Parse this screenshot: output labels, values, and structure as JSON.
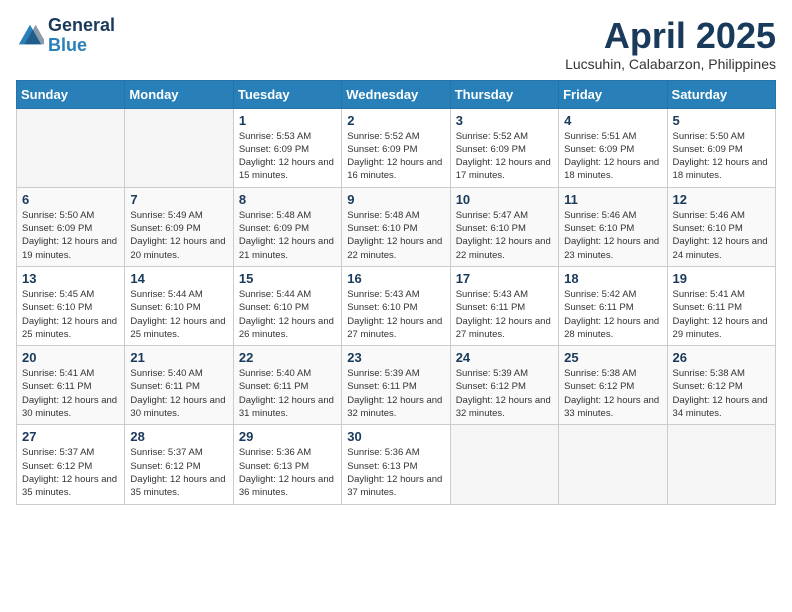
{
  "header": {
    "logo_general": "General",
    "logo_blue": "Blue",
    "month_title": "April 2025",
    "location": "Lucsuhin, Calabarzon, Philippines"
  },
  "days_of_week": [
    "Sunday",
    "Monday",
    "Tuesday",
    "Wednesday",
    "Thursday",
    "Friday",
    "Saturday"
  ],
  "weeks": [
    [
      {
        "day": "",
        "info": ""
      },
      {
        "day": "",
        "info": ""
      },
      {
        "day": "1",
        "info": "Sunrise: 5:53 AM\nSunset: 6:09 PM\nDaylight: 12 hours and 15 minutes."
      },
      {
        "day": "2",
        "info": "Sunrise: 5:52 AM\nSunset: 6:09 PM\nDaylight: 12 hours and 16 minutes."
      },
      {
        "day": "3",
        "info": "Sunrise: 5:52 AM\nSunset: 6:09 PM\nDaylight: 12 hours and 17 minutes."
      },
      {
        "day": "4",
        "info": "Sunrise: 5:51 AM\nSunset: 6:09 PM\nDaylight: 12 hours and 18 minutes."
      },
      {
        "day": "5",
        "info": "Sunrise: 5:50 AM\nSunset: 6:09 PM\nDaylight: 12 hours and 18 minutes."
      }
    ],
    [
      {
        "day": "6",
        "info": "Sunrise: 5:50 AM\nSunset: 6:09 PM\nDaylight: 12 hours and 19 minutes."
      },
      {
        "day": "7",
        "info": "Sunrise: 5:49 AM\nSunset: 6:09 PM\nDaylight: 12 hours and 20 minutes."
      },
      {
        "day": "8",
        "info": "Sunrise: 5:48 AM\nSunset: 6:09 PM\nDaylight: 12 hours and 21 minutes."
      },
      {
        "day": "9",
        "info": "Sunrise: 5:48 AM\nSunset: 6:10 PM\nDaylight: 12 hours and 22 minutes."
      },
      {
        "day": "10",
        "info": "Sunrise: 5:47 AM\nSunset: 6:10 PM\nDaylight: 12 hours and 22 minutes."
      },
      {
        "day": "11",
        "info": "Sunrise: 5:46 AM\nSunset: 6:10 PM\nDaylight: 12 hours and 23 minutes."
      },
      {
        "day": "12",
        "info": "Sunrise: 5:46 AM\nSunset: 6:10 PM\nDaylight: 12 hours and 24 minutes."
      }
    ],
    [
      {
        "day": "13",
        "info": "Sunrise: 5:45 AM\nSunset: 6:10 PM\nDaylight: 12 hours and 25 minutes."
      },
      {
        "day": "14",
        "info": "Sunrise: 5:44 AM\nSunset: 6:10 PM\nDaylight: 12 hours and 25 minutes."
      },
      {
        "day": "15",
        "info": "Sunrise: 5:44 AM\nSunset: 6:10 PM\nDaylight: 12 hours and 26 minutes."
      },
      {
        "day": "16",
        "info": "Sunrise: 5:43 AM\nSunset: 6:10 PM\nDaylight: 12 hours and 27 minutes."
      },
      {
        "day": "17",
        "info": "Sunrise: 5:43 AM\nSunset: 6:11 PM\nDaylight: 12 hours and 27 minutes."
      },
      {
        "day": "18",
        "info": "Sunrise: 5:42 AM\nSunset: 6:11 PM\nDaylight: 12 hours and 28 minutes."
      },
      {
        "day": "19",
        "info": "Sunrise: 5:41 AM\nSunset: 6:11 PM\nDaylight: 12 hours and 29 minutes."
      }
    ],
    [
      {
        "day": "20",
        "info": "Sunrise: 5:41 AM\nSunset: 6:11 PM\nDaylight: 12 hours and 30 minutes."
      },
      {
        "day": "21",
        "info": "Sunrise: 5:40 AM\nSunset: 6:11 PM\nDaylight: 12 hours and 30 minutes."
      },
      {
        "day": "22",
        "info": "Sunrise: 5:40 AM\nSunset: 6:11 PM\nDaylight: 12 hours and 31 minutes."
      },
      {
        "day": "23",
        "info": "Sunrise: 5:39 AM\nSunset: 6:11 PM\nDaylight: 12 hours and 32 minutes."
      },
      {
        "day": "24",
        "info": "Sunrise: 5:39 AM\nSunset: 6:12 PM\nDaylight: 12 hours and 32 minutes."
      },
      {
        "day": "25",
        "info": "Sunrise: 5:38 AM\nSunset: 6:12 PM\nDaylight: 12 hours and 33 minutes."
      },
      {
        "day": "26",
        "info": "Sunrise: 5:38 AM\nSunset: 6:12 PM\nDaylight: 12 hours and 34 minutes."
      }
    ],
    [
      {
        "day": "27",
        "info": "Sunrise: 5:37 AM\nSunset: 6:12 PM\nDaylight: 12 hours and 35 minutes."
      },
      {
        "day": "28",
        "info": "Sunrise: 5:37 AM\nSunset: 6:12 PM\nDaylight: 12 hours and 35 minutes."
      },
      {
        "day": "29",
        "info": "Sunrise: 5:36 AM\nSunset: 6:13 PM\nDaylight: 12 hours and 36 minutes."
      },
      {
        "day": "30",
        "info": "Sunrise: 5:36 AM\nSunset: 6:13 PM\nDaylight: 12 hours and 37 minutes."
      },
      {
        "day": "",
        "info": ""
      },
      {
        "day": "",
        "info": ""
      },
      {
        "day": "",
        "info": ""
      }
    ]
  ]
}
